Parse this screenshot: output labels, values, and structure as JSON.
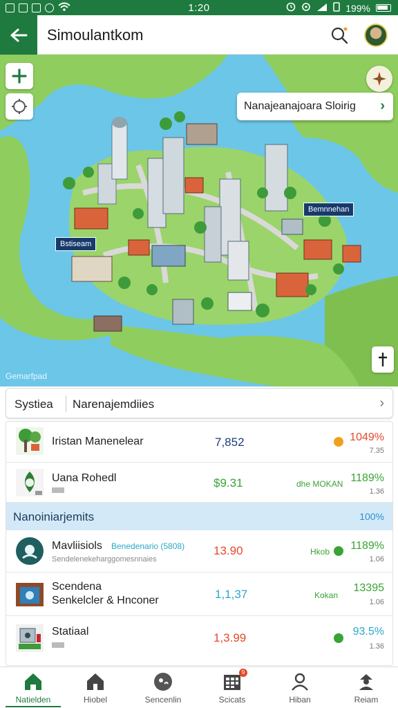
{
  "status_bar": {
    "time": "1:20",
    "battery": "199%"
  },
  "app_bar": {
    "title": "Simoulantkom"
  },
  "map": {
    "callout": "Nanajeanajoara Sloirig",
    "label_right": "Bemnnehan",
    "label_left": "Bstiseam",
    "corner_label": "Gemarfpad"
  },
  "search_strip": {
    "label": "Systiea",
    "value": "Narenajemdiies"
  },
  "list": {
    "rows": [
      {
        "name": "Iristan Manenelear",
        "value": "7,852",
        "pct": "1049%",
        "pct_sub": "7.35",
        "value_color": "#1b3a7a",
        "pct_color": "#e4492b",
        "dot_color": "#f0a020"
      },
      {
        "name": "Uana Rohedl",
        "value": "$9.31",
        "tag": "dhe MOKAN",
        "pct": "1189%",
        "pct_sub": "1.36",
        "value_color": "#3aa335",
        "pct_color": "#3aa335"
      }
    ],
    "section": {
      "title": "Nanoiniarjemits",
      "value": "100%"
    },
    "rows2": [
      {
        "name": "Mavliisiols",
        "name_tag": "Benedenario (5808)",
        "sub": "Sendelenekeharggomesnnaies",
        "value": "13.90",
        "tag": "Hkob",
        "pct": "1189%",
        "pct_sub": "1.06",
        "value_color": "#e4492b",
        "pct_color": "#3aa335",
        "dot_color": "#3aa335"
      },
      {
        "name": "Scendena",
        "name2": "Senkelcler & Hnconer",
        "value": "1,1,37",
        "tag": "Kokan",
        "pct": "13395",
        "pct_sub": "1.06",
        "value_color": "#2aa8c8",
        "pct_color": "#3aa335"
      },
      {
        "name": "Statiaal",
        "value": "1,3.99",
        "pct": "93.5%",
        "pct_sub": "1.36",
        "value_color": "#e4492b",
        "pct_color": "#2aa8c8",
        "dot_color": "#3aa335"
      }
    ]
  },
  "bottom_nav": {
    "items": [
      {
        "label": "Natielden",
        "icon": "home-icon",
        "active": true
      },
      {
        "label": "Hiobel",
        "icon": "house-icon"
      },
      {
        "label": "Sencenlin",
        "icon": "chat-icon"
      },
      {
        "label": "Scicats",
        "icon": "grid-icon",
        "badge": "9"
      },
      {
        "label": "Hiban",
        "icon": "person-icon"
      },
      {
        "label": "Reiam",
        "icon": "profile-icon"
      }
    ]
  },
  "colors": {
    "brand_green": "#1f7a3f",
    "water": "#6cc6e8",
    "land": "#8fce5e"
  }
}
